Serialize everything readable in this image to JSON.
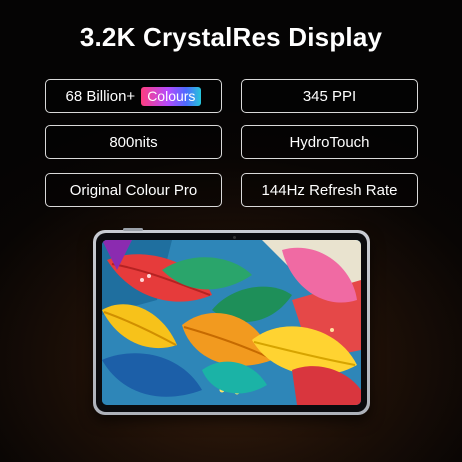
{
  "title": "3.2K CrystalRes Display",
  "specs": {
    "billion": "68 Billion+",
    "colours_badge": "Colours",
    "ppi": "345 PPI",
    "nits": "800nits",
    "touch": "HydroTouch",
    "colour_pro": "Original Colour Pro",
    "refresh": "144Hz Refresh Rate"
  },
  "colors": {
    "border": "#d9d9d9",
    "badge_gradient": [
      "#ff3d7f",
      "#b44bff",
      "#4c6bff",
      "#26c6da"
    ],
    "background": "#0a0605"
  },
  "image": {
    "subject": "tablet",
    "screen_art": "colorful abstract leaves"
  }
}
